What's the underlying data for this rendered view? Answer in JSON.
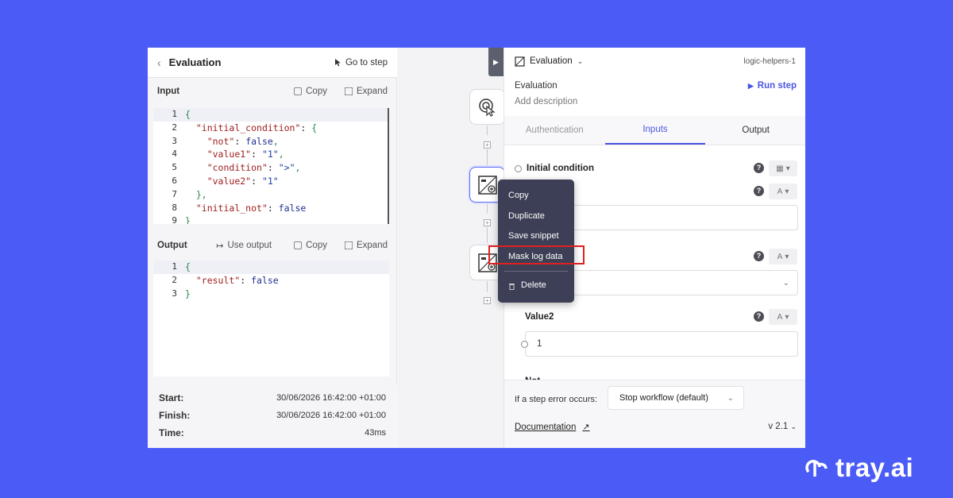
{
  "left": {
    "title": "Evaluation",
    "go_to_step": "Go to step",
    "input": {
      "label": "Input",
      "copy": "Copy",
      "expand": "Expand",
      "lines": [
        {
          "n": "1",
          "text": "{"
        },
        {
          "n": "2",
          "text": "  \"initial_condition\": {"
        },
        {
          "n": "3",
          "text": "    \"not\": false,"
        },
        {
          "n": "4",
          "text": "    \"value1\": \"1\","
        },
        {
          "n": "5",
          "text": "    \"condition\": \">\","
        },
        {
          "n": "6",
          "text": "    \"value2\": \"1\""
        },
        {
          "n": "7",
          "text": "  },"
        },
        {
          "n": "8",
          "text": "  \"initial_not\": false"
        },
        {
          "n": "9",
          "text": "}"
        }
      ]
    },
    "output": {
      "label": "Output",
      "use_output": "Use output",
      "copy": "Copy",
      "expand": "Expand",
      "lines": [
        {
          "n": "1",
          "text": "{"
        },
        {
          "n": "2",
          "text": "  \"result\": false"
        },
        {
          "n": "3",
          "text": "}"
        }
      ]
    },
    "timing": {
      "start_label": "Start:",
      "start_value": "30/06/2026 16:42:00 +01:00",
      "finish_label": "Finish:",
      "finish_value": "30/06/2026 16:42:00 +01:00",
      "time_label": "Time:",
      "time_value": "43ms"
    }
  },
  "menu": {
    "items": [
      "Copy",
      "Duplicate",
      "Save snippet",
      "Mask log data"
    ],
    "delete": "Delete"
  },
  "right": {
    "connector": "Evaluation",
    "step_id": "logic-helpers-1",
    "step_name": "Evaluation",
    "description": "Add description",
    "run_step": "Run step",
    "tabs": [
      "Authentication",
      "Inputs",
      "Output"
    ],
    "initial_condition": "Initial condition",
    "value2_label": "Value2",
    "value2_value": "1",
    "not_label": "Not",
    "error_label": "If a step error occurs:",
    "error_option": "Stop workflow (default)",
    "documentation": "Documentation",
    "version": "v 2.1"
  },
  "brand": "tray.ai",
  "colors": {
    "background": "#4b5cf6",
    "accent": "#4a55e0",
    "highlight": "#e02020",
    "menu": "#3c3f55"
  }
}
